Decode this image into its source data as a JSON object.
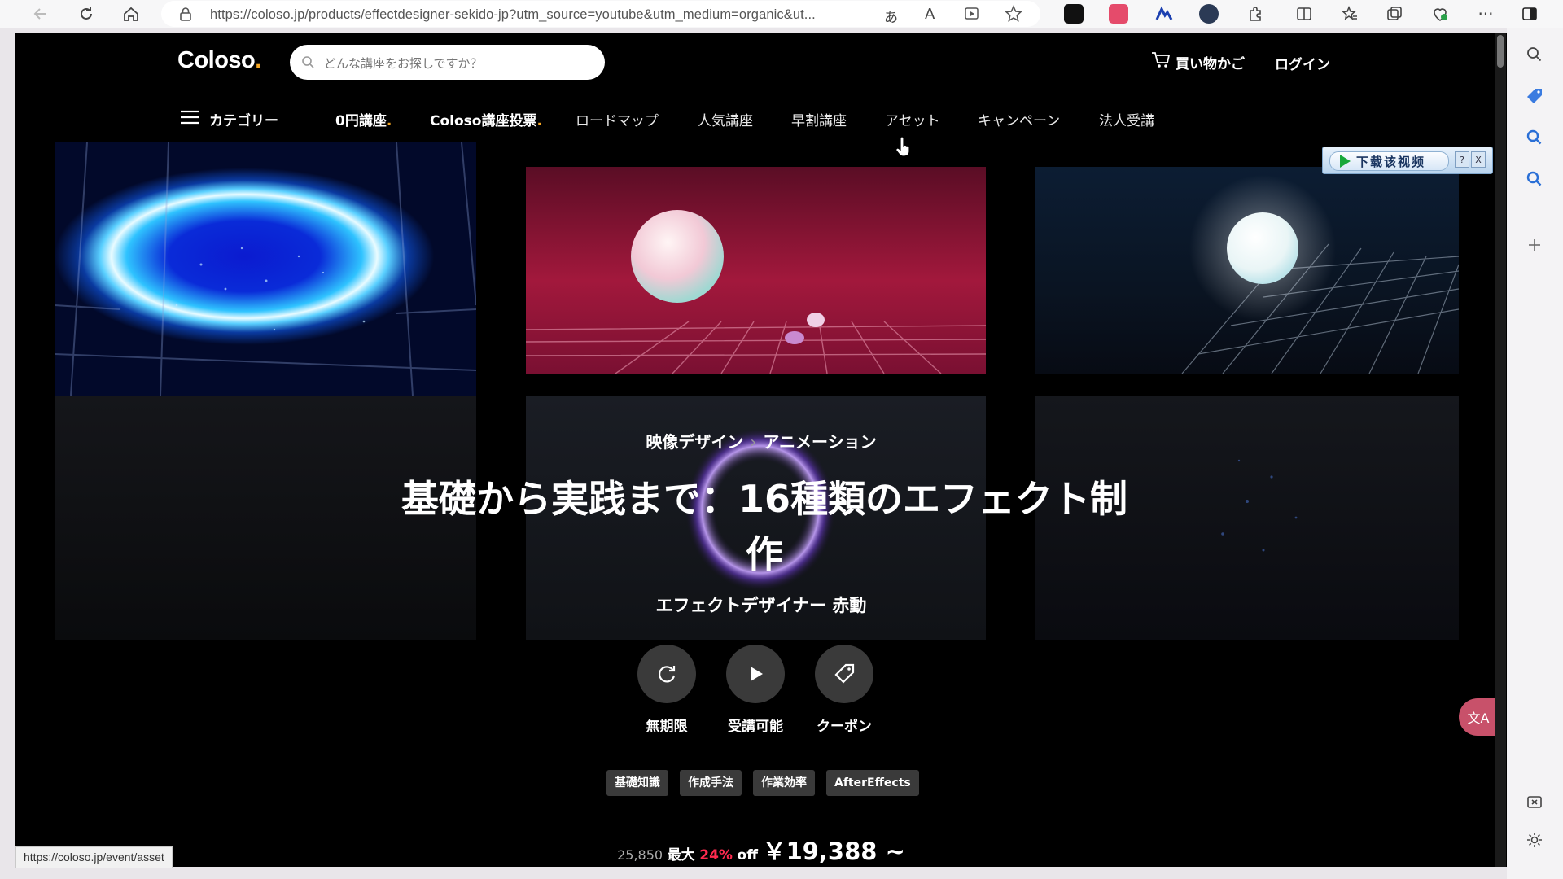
{
  "browser": {
    "url": "https://coloso.jp/products/effectdesigner-sekido-jp?utm_source=youtube&utm_medium=organic&ut...",
    "status_url": "https://coloso.jp/event/asset",
    "read_aloud_label": "A",
    "translate_label": "あ"
  },
  "header": {
    "logo_text": "Coloso",
    "logo_dot": ".",
    "search_placeholder": "どんな講座をお探しですか？",
    "cart_label": "買い物かご",
    "login_label": "ログイン"
  },
  "nav": {
    "category": "カテゴリー",
    "free_courses": "0円講座",
    "vote": "Coloso講座投票",
    "dot": ".",
    "roadmap": "ロードマップ",
    "popular": "人気講座",
    "early_discount": "早割講座",
    "assets": "アセット",
    "campaign": "キャンペーン",
    "corporate": "法人受講"
  },
  "overlay_ad": {
    "label": "下载该视频",
    "help": "?",
    "close": "X"
  },
  "course": {
    "breadcrumb_parent": "映像デザイン",
    "breadcrumb_child": "アニメーション",
    "title_line1": "基礎から実践まで：16種類のエフェクト制",
    "title_line2": "作",
    "author": "エフェクトデザイナー 赤動",
    "features": [
      {
        "label": "無期限",
        "icon": "refresh-icon"
      },
      {
        "label": "受講可能",
        "icon": "play-icon"
      },
      {
        "label": "クーポン",
        "icon": "tag-icon"
      }
    ],
    "tags": [
      "基礎知識",
      "作成手法",
      "作業効率",
      "AfterEffects"
    ],
    "price": {
      "original": "25,850",
      "max_label": "最大",
      "percent": "24%",
      "off_label": "off",
      "current": "￥19,388 ~"
    }
  },
  "translate_widget": {
    "label": "文A"
  },
  "colors": {
    "accent_orange": "#f5a623",
    "discount_red": "#ff2a4f",
    "page_bg": "#000000"
  }
}
